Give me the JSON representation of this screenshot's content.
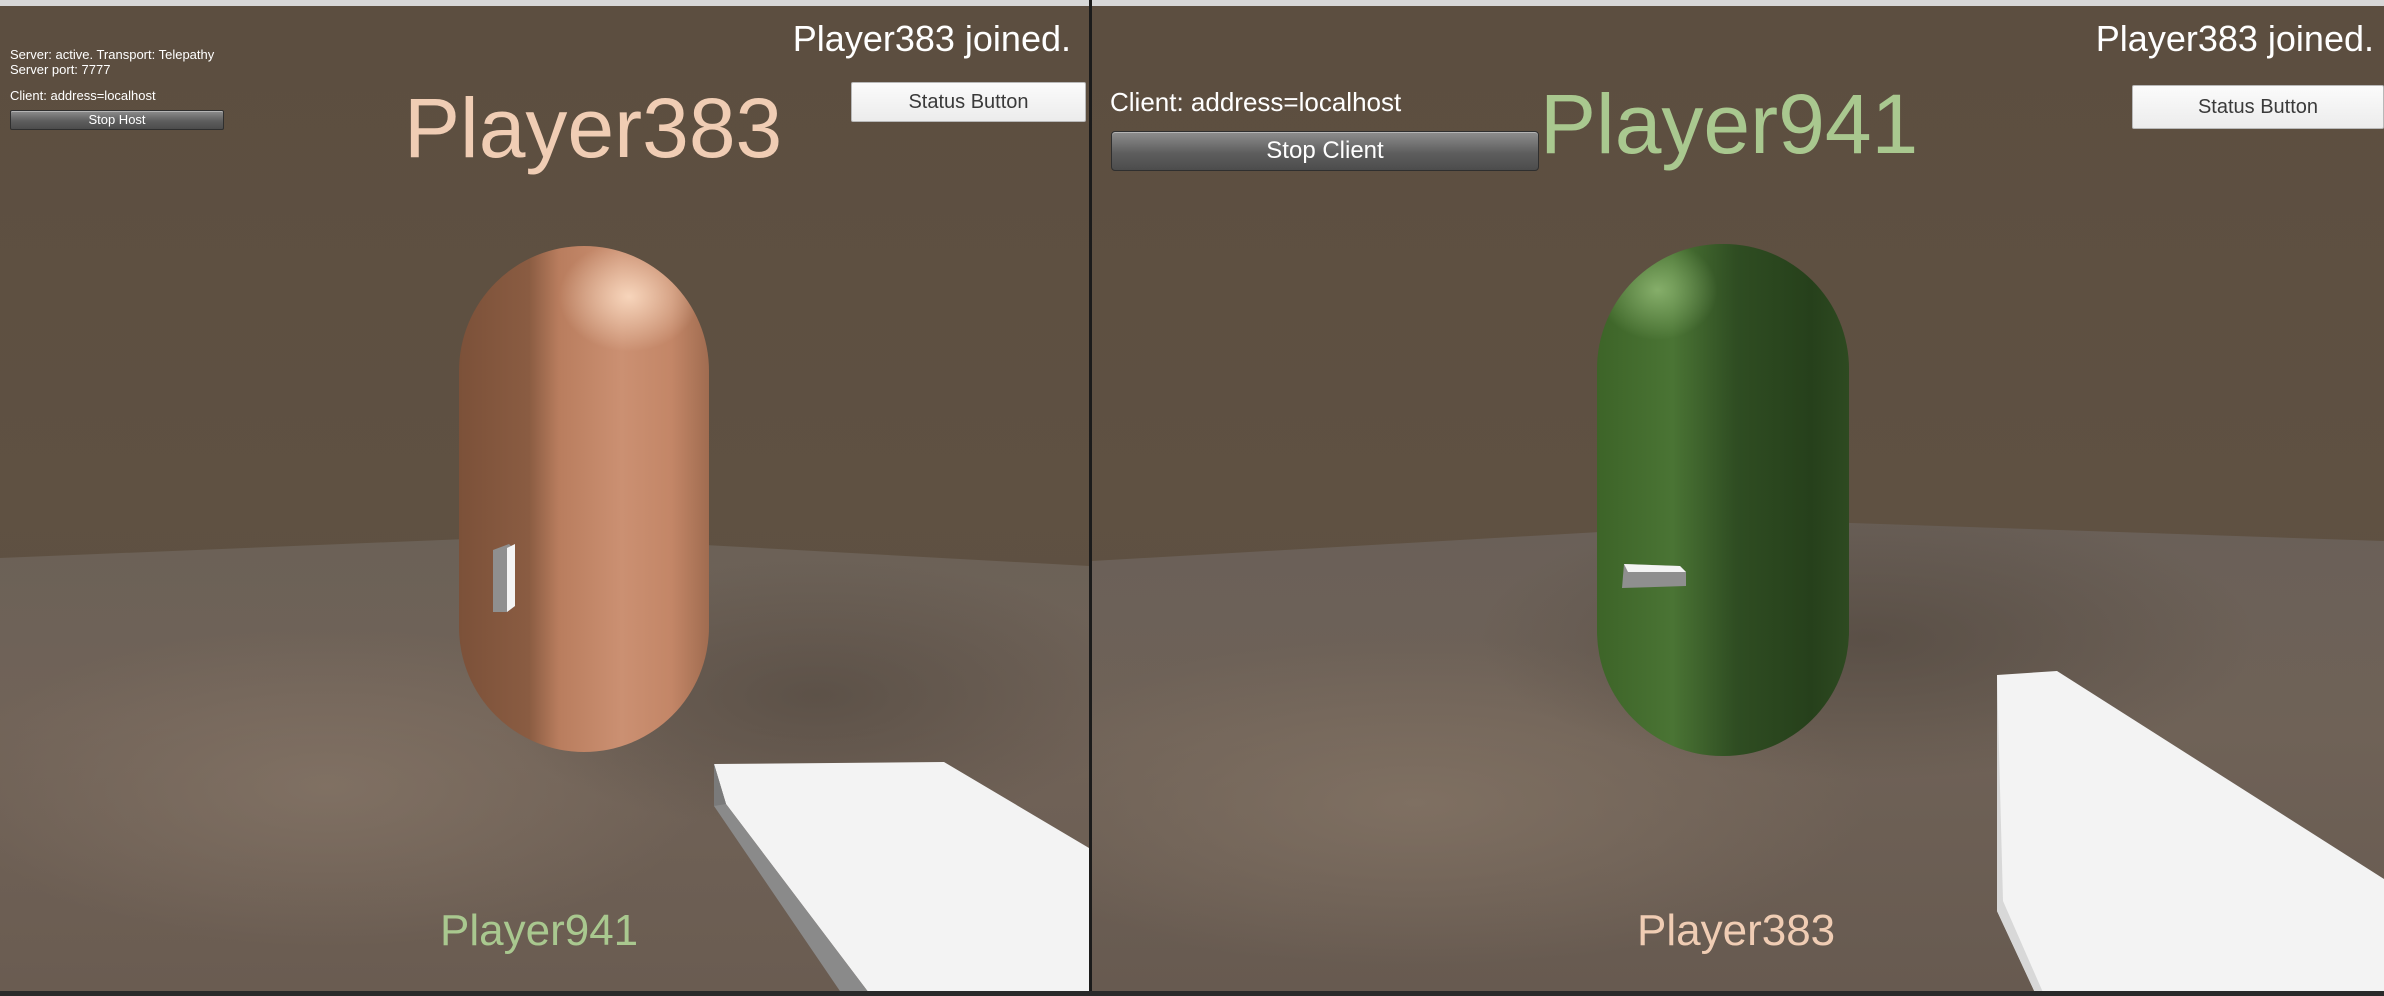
{
  "left_view": {
    "joined_message": "Player383 joined.",
    "status_button_label": "Status Button",
    "server_status": "Server: active. Transport: Telepathy",
    "server_port": "Server port: 7777",
    "client_address": "Client: address=localhost",
    "stop_button_label": "Stop Host",
    "local_player_name": "Player383",
    "other_player_name": "Player941",
    "local_player_color": "#f0cdb4",
    "other_player_color": "#a9c88f",
    "capsule_color": "#c08463"
  },
  "right_view": {
    "joined_message": "Player383 joined.",
    "status_button_label": "Status Button",
    "client_address": "Client: address=localhost",
    "stop_button_label": "Stop Client",
    "local_player_name": "Player941",
    "other_player_name": "Player383",
    "local_player_color": "#a9c88f",
    "other_player_color": "#f0cdb4",
    "capsule_color": "#3a5f28"
  },
  "colors": {
    "sky": "#5e5041",
    "ground": "#6c6159",
    "item": "#f2f2f2"
  }
}
